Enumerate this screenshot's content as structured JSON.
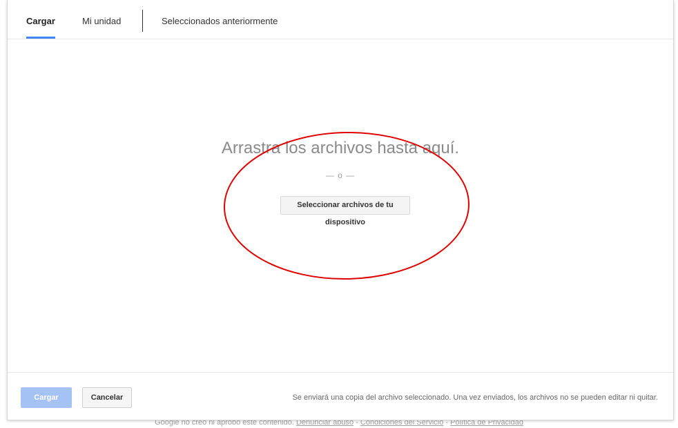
{
  "tabs": [
    {
      "label": "Cargar",
      "active": true
    },
    {
      "label": "Mi unidad",
      "active": false
    },
    {
      "label": "Seleccionados anteriormente",
      "active": false
    }
  ],
  "dropzone": {
    "title": "Arrastra los archivos hasta aquí.",
    "or_text": "— o —",
    "select_button": "Seleccionar archivos de tu dispositivo"
  },
  "footer": {
    "upload_button": "Cargar",
    "cancel_button": "Cancelar",
    "notice": "Se enviará una copia del archivo seleccionado. Una vez enviados, los archivos no se pueden editar ni quitar."
  },
  "page_footer": {
    "disclaimer": "Google no creó ni aprobó este contenido.",
    "report_link": "Denunciar abuso",
    "separator": "-",
    "terms_link": "Condiciones del Servicio",
    "privacy_link": "Política de Privacidad"
  },
  "colors": {
    "accent": "#4285f4",
    "primary_disabled": "#a4c2f4",
    "annotation": "#e00000"
  }
}
